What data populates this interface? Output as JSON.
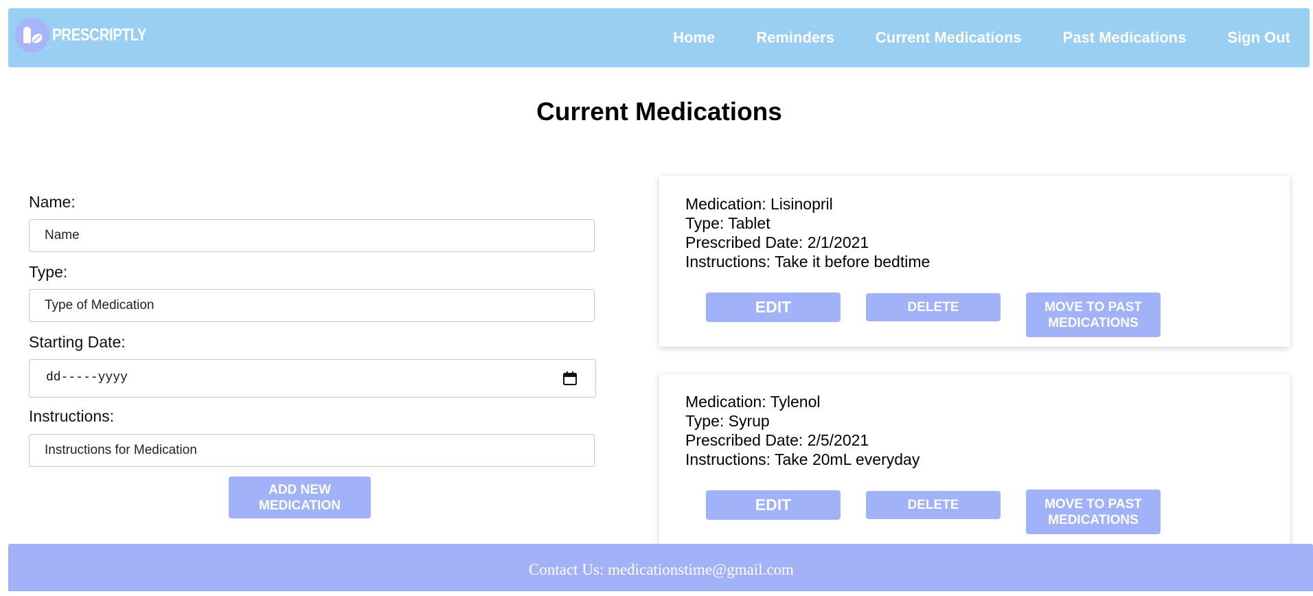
{
  "brand": {
    "name": "PRESCRIPTLY",
    "icon": "pill-icon",
    "colors": {
      "navbar": "#99cff3",
      "accent": "#a1b2f9"
    }
  },
  "nav": {
    "items": [
      {
        "label": "Home"
      },
      {
        "label": "Reminders"
      },
      {
        "label": "Current Medications"
      },
      {
        "label": "Past Medications"
      },
      {
        "label": "Sign Out"
      }
    ]
  },
  "page": {
    "title": "Current Medications"
  },
  "form": {
    "name_label": "Name:",
    "name_placeholder": "Name",
    "type_label": "Type:",
    "type_placeholder": "Type of Medication",
    "date_label": "Starting Date:",
    "date_placeholder": "dd-----yyyy",
    "date_icon": "calendar-icon",
    "instructions_label": "Instructions:",
    "instructions_placeholder": "Instructions for Medication",
    "add_button_label": "ADD NEW MEDICATION"
  },
  "medications": [
    {
      "medication": "Medication: Lisinopril",
      "type": "Type: Tablet",
      "date": "Prescribed Date: 2/1/2021",
      "instructions": "Instructions: Take it before bedtime",
      "edit_label": "EDIT",
      "delete_label": "DELETE",
      "move_label": "MOVE TO PAST MEDICATIONS"
    },
    {
      "medication": "Medication: Tylenol",
      "type": "Type: Syrup",
      "date": "Prescribed Date: 2/5/2021",
      "instructions": "Instructions: Take 20mL everyday",
      "edit_label": "EDIT",
      "delete_label": "DELETE",
      "move_label": "MOVE TO PAST MEDICATIONS"
    }
  ],
  "footer": {
    "contact": "Contact Us: medicationstime@gmail.com"
  }
}
